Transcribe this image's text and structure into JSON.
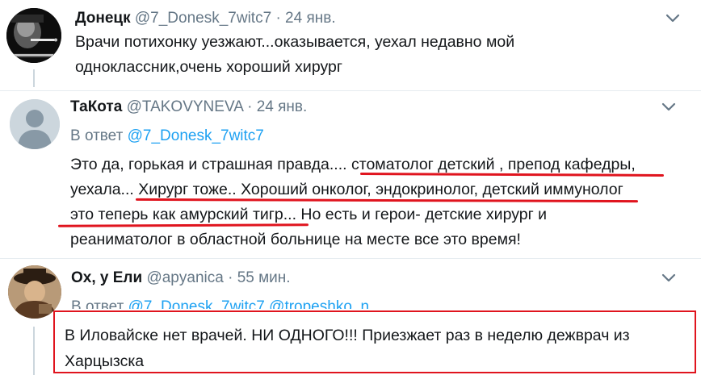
{
  "tweets": [
    {
      "name": "Донецк",
      "handle": "@7_Donesk_7witc7",
      "dot": "·",
      "time": "24 янв.",
      "text_lines": [
        "Врачи потихонку уезжают...оказывается, уехал недавно мой",
        "одноклассник,очень хороший хирург"
      ],
      "avatar_icon": "smoking-person-photo",
      "menu_icon": "chevron-down-icon"
    },
    {
      "name": "ТаКота",
      "handle": "@TAKOVYNEVA",
      "dot": "·",
      "time": "24 янв.",
      "reply_prefix": "В ответ",
      "reply_to": "@7_Donesk_7witc7",
      "text_lines": [
        "Это да, горькая и страшная правда.... стоматолог детский , препод кафедры,",
        "уехала... Хирург тоже.. Хороший онколог, эндокринолог, детский иммунолог",
        "это теперь как амурский тигр... Но есть и герои- детские хирург и",
        "реаниматолог в областной больнице на месте все это время!"
      ],
      "avatar_icon": "default-profile-icon",
      "menu_icon": "chevron-down-icon"
    },
    {
      "name": "Ох, у Ели",
      "handle": "@apyanica",
      "dot": "·",
      "time": "55 мин.",
      "reply_prefix": "В ответ",
      "reply_to": "@7_Donesk_7witc7 @tropeshko_n",
      "text_lines": [
        "В Иловайске нет врачей. НИ ОДНОГО!!! Приезжает раз в неделю дежврач из",
        "Харцызска"
      ],
      "avatar_icon": "person-with-hat-photo",
      "menu_icon": "chevron-down-icon"
    }
  ],
  "colors": {
    "link": "#1da1f2",
    "secondary_text": "#657786",
    "highlight_red": "#e0141e",
    "divider": "#e6ecf0",
    "thread_line": "#ccd6dd"
  }
}
